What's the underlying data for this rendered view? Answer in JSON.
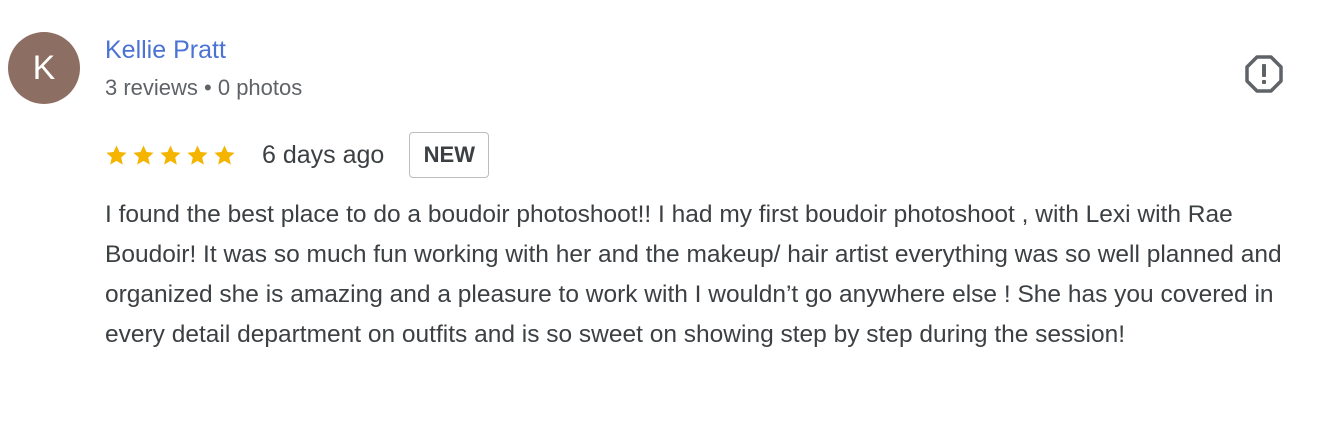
{
  "reviewer": {
    "initial": "K",
    "name": "Kellie Pratt",
    "meta": "3 reviews • 0 photos",
    "avatar_color": "#8d6e63",
    "name_color": "#4a73d4"
  },
  "report": {
    "icon": "report-flag-icon"
  },
  "rating": {
    "stars": 5,
    "max_stars": 5,
    "star_color": "#f4b400",
    "time": "6 days ago",
    "badge": "NEW"
  },
  "review": {
    "text": "I found the best place to do a boudoir photoshoot!! I had my first boudoir photoshoot , with Lexi with Rae Boudoir! It was so much fun working with her and the makeup/ hair artist everything was so well planned and organized she is amazing and a pleasure to work with I wouldn’t go anywhere else ! She has you covered in every detail department on outfits and is so sweet on showing step by step during the session!"
  }
}
